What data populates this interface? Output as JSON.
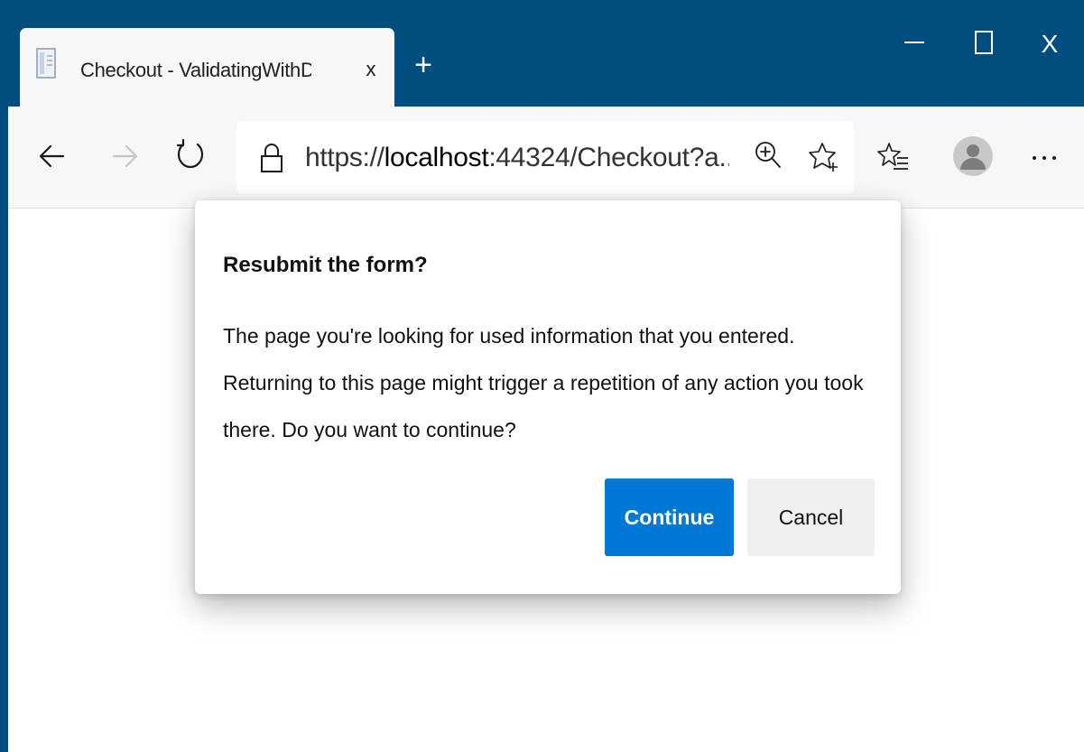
{
  "browser": {
    "tab": {
      "title": "Checkout - ValidatingWithDataA",
      "favicon": "document-icon",
      "close_glyph": "x"
    },
    "new_tab_glyph": "+",
    "window_controls": {
      "minimize": "minimize-icon",
      "maximize": "maximize-icon",
      "close_glyph": "X"
    },
    "toolbar": {
      "back": "back-arrow-icon",
      "forward": "forward-arrow-icon",
      "refresh": "refresh-icon",
      "favorites": "favorites-icon",
      "profile": "avatar",
      "more_glyph": "..."
    },
    "address": {
      "scheme": "https://",
      "host": "localhost",
      "rest": ":44324/Checkout?a...",
      "lock": "lock-icon",
      "zoom": "zoom-in-icon",
      "add_favorite": "add-favorite-icon"
    }
  },
  "dialog": {
    "title": "Resubmit the form?",
    "message": "The page you're looking for used information that you entered. Returning to this page might trigger a repetition of any action you took there. Do you want to continue?",
    "continue_label": "Continue",
    "cancel_label": "Cancel"
  },
  "colors": {
    "title_bar": "#004e80",
    "toolbar": "#f7f7f7",
    "primary_button": "#0078d4",
    "secondary_button": "#efefef"
  }
}
